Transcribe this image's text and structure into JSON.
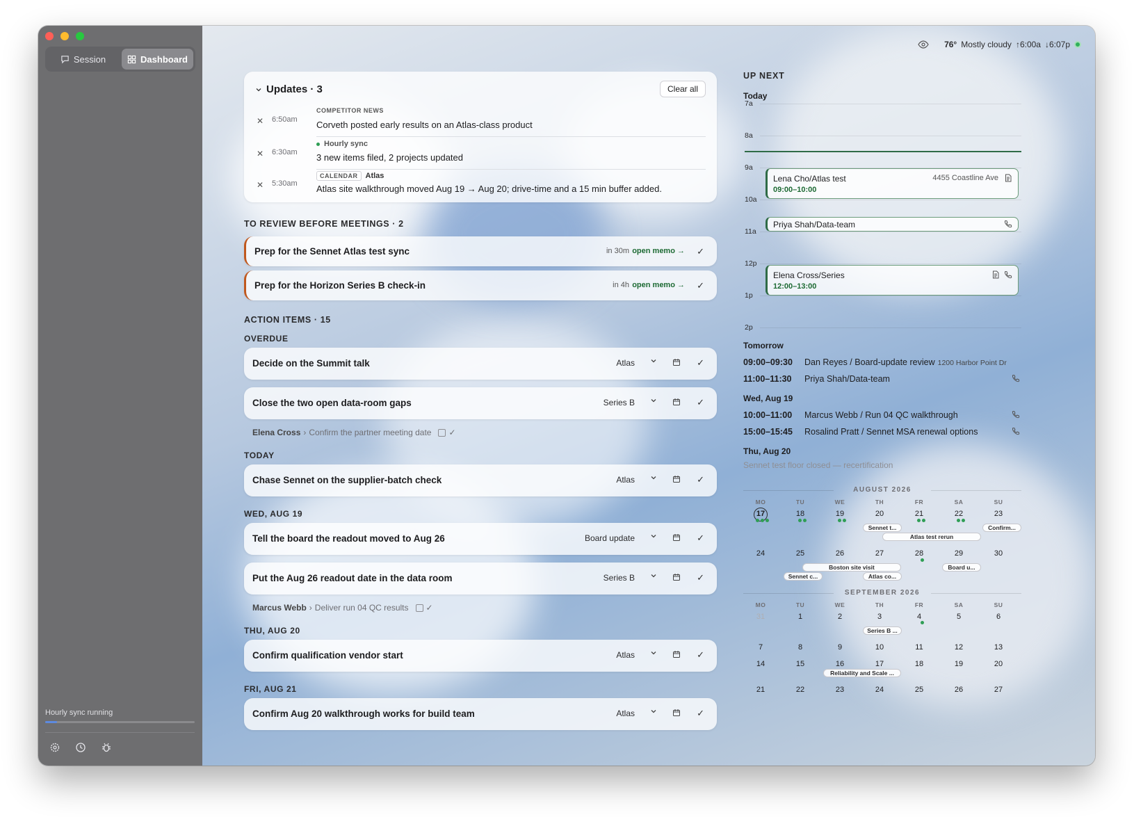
{
  "sidebar": {
    "session_label": "Session",
    "dashboard_label": "Dashboard",
    "sync_status": "Hourly sync running",
    "sync_progress": 0.08,
    "tools": [
      "gear-icon",
      "clock-icon",
      "bug-icon"
    ]
  },
  "weather": {
    "temp": "76°",
    "desc": "Mostly cloudy",
    "sunrise": "↑6:00a",
    "sunset": "↓6:07p"
  },
  "updates": {
    "title": "Updates · 3",
    "clear_label": "Clear all",
    "items": [
      {
        "time": "6:50am",
        "tag": "COMPETITOR NEWS",
        "project": "",
        "msg": "Corveth posted early results on an Atlas-class product"
      },
      {
        "time": "6:30am",
        "tag": "Hourly sync",
        "project": "",
        "msg": "3 new items filed, 2 projects updated"
      },
      {
        "time": "5:30am",
        "tag": "CALENDAR",
        "project": "Atlas",
        "msg": "Atlas site walkthrough moved Aug 19 → Aug 20; drive-time and a 15 min buffer added."
      }
    ]
  },
  "review": {
    "title": "TO REVIEW BEFORE MEETINGS · 2",
    "items": [
      {
        "title": "Prep for the Sennet Atlas test sync",
        "due": "in 30m",
        "link": "open memo →"
      },
      {
        "title": "Prep for the Horizon Series B check-in",
        "due": "in 4h",
        "link": "open memo →"
      }
    ]
  },
  "actions": {
    "title": "ACTION ITEMS · 15",
    "groups": {
      "overdue": "OVERDUE",
      "today": "TODAY",
      "wed": "WED, AUG 19",
      "thu": "THU, AUG 20",
      "fri": "FRI, AUG 21"
    },
    "items": [
      {
        "title": "Decide on the Summit talk",
        "project": "Atlas"
      },
      {
        "title": "Close the two open data-room gaps",
        "project": "Series B"
      },
      {
        "title": "Chase Sennet on the supplier-batch check",
        "project": "Atlas"
      },
      {
        "title": "Tell the board the readout moved to Aug 26",
        "project": "Board update"
      },
      {
        "title": "Put the Aug 26 readout date in the data room",
        "project": "Series B"
      },
      {
        "title": "Confirm qualification vendor start",
        "project": "Atlas"
      },
      {
        "title": "Confirm Aug 20 walkthrough works for build team",
        "project": "Atlas"
      }
    ],
    "subs": [
      {
        "person": "Elena Cross",
        "task": "Confirm the partner meeting date"
      },
      {
        "person": "Marcus Webb",
        "task": "Deliver run 04 QC results"
      }
    ]
  },
  "upnext": {
    "title": "UP NEXT",
    "today": "Today",
    "hours": [
      "7a",
      "8a",
      "9a",
      "10a",
      "11a",
      "12p",
      "1p",
      "2p"
    ],
    "events": [
      {
        "name": "Lena Cho/Atlas test",
        "time": "09:00–10:00",
        "loc": "4455 Coastline Ave"
      },
      {
        "name": "Priya Shah/Data-team",
        "time": "",
        "loc": ""
      },
      {
        "name": "Elena Cross/Series",
        "time": "12:00–13:00",
        "loc": ""
      }
    ],
    "tomorrow": "Tomorrow",
    "tomorrow_items": [
      {
        "time": "09:00–09:30",
        "name": "Dan Reyes / Board-update review",
        "loc": "1200 Harbor Point Dr"
      },
      {
        "time": "11:00–11:30",
        "name": "Priya Shah/Data-team",
        "loc": ""
      }
    ],
    "wed": "Wed, Aug 19",
    "wed_items": [
      {
        "time": "10:00–11:00",
        "name": "Marcus Webb / Run 04 QC walkthrough",
        "loc": ""
      },
      {
        "time": "15:00–15:45",
        "name": "Rosalind Pratt / Sennet MSA renewal options",
        "loc": ""
      }
    ],
    "thu": "Thu, Aug 20",
    "thu_note": "Sennet test floor closed — recertification"
  },
  "calendar": {
    "dow": [
      "MO",
      "TU",
      "WE",
      "TH",
      "FR",
      "SA",
      "SU"
    ],
    "aug": {
      "title": "AUGUST 2026",
      "weeks": [
        [
          "17",
          "18",
          "19",
          "20",
          "21",
          "22",
          "23"
        ],
        [
          "24",
          "25",
          "26",
          "27",
          "28",
          "29",
          "30"
        ]
      ],
      "chips": [
        "Sennet t...",
        "Atlas test rerun",
        "Confirm...",
        "Boston site visit",
        "Sennet c...",
        "Atlas co...",
        "Board u..."
      ]
    },
    "sep": {
      "title": "SEPTEMBER 2026",
      "weeks": [
        [
          "31",
          "1",
          "2",
          "3",
          "4",
          "5",
          "6"
        ],
        [
          "7",
          "8",
          "9",
          "10",
          "11",
          "12",
          "13"
        ],
        [
          "14",
          "15",
          "16",
          "17",
          "18",
          "19",
          "20"
        ],
        [
          "21",
          "22",
          "23",
          "24",
          "25",
          "26",
          "27"
        ]
      ],
      "chips": [
        "Series B ...",
        "Reliability and Scale ..."
      ]
    }
  }
}
